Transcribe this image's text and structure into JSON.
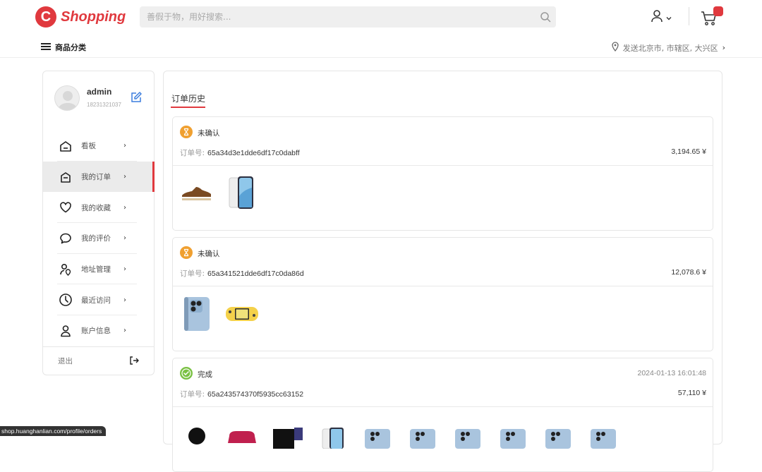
{
  "header": {
    "logo_mark": "C",
    "logo_text": "Shopping",
    "search_placeholder": "善假于物，用好搜索..."
  },
  "subbar": {
    "categories_label": "商品分类",
    "delivery_text": "发送北京市, 市辖区, 大兴区"
  },
  "profile": {
    "username": "admin",
    "phone": "18231321037"
  },
  "menu": [
    {
      "label": "看板",
      "icon": "home-icon",
      "active": false
    },
    {
      "label": "我的订单",
      "icon": "order-bag-icon",
      "active": true
    },
    {
      "label": "我的收藏",
      "icon": "heart-icon",
      "active": false
    },
    {
      "label": "我的评价",
      "icon": "comment-icon",
      "active": false
    },
    {
      "label": "地址管理",
      "icon": "location-user-icon",
      "active": false
    },
    {
      "label": "最近访问",
      "icon": "clock-icon",
      "active": false
    },
    {
      "label": "账户信息",
      "icon": "user-icon",
      "active": false
    }
  ],
  "logout_label": "退出",
  "orders_section": {
    "title": "订单历史",
    "id_label": "订单号:",
    "orders": [
      {
        "status": "未确认",
        "status_icon": "hourglass-icon",
        "time": "",
        "id": "65a34d3e1dde6df17c0dabff",
        "price": "3,194.65 ¥",
        "items": [
          "shoe",
          "iphone-white"
        ]
      },
      {
        "status": "未确认",
        "status_icon": "hourglass-icon",
        "time": "",
        "id": "65a341521dde6df17c0da86d",
        "price": "12,078.6 ¥",
        "items": [
          "iphone-blue",
          "switch-lite"
        ]
      },
      {
        "status": "完成",
        "status_icon": "check-circle-icon",
        "time": "2024-01-13 16:01:48",
        "id": "65a243574370f5935cc63152",
        "price": "57,110 ¥",
        "items": [
          "speaker",
          "controller",
          "console",
          "iphone-white",
          "iphone-blue",
          "iphone-blue",
          "iphone-blue",
          "iphone-blue",
          "iphone-blue",
          "iphone-blue"
        ]
      }
    ]
  },
  "statusbar_url": "shop.huanghanlian.com/profile/orders",
  "colors": {
    "accent": "#e0393e",
    "pending": "#f0a030",
    "done": "#7ac143"
  }
}
